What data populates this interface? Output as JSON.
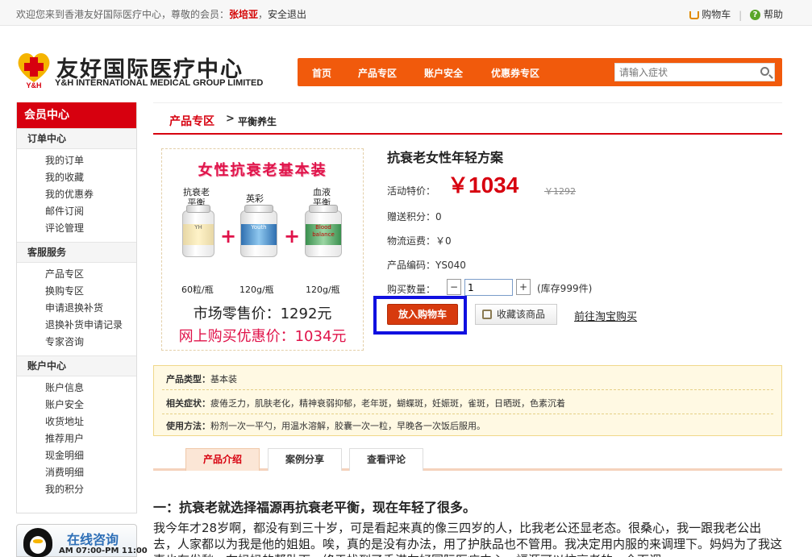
{
  "topbar": {
    "welcome_prefix": "欢迎您来到香港友好国际医疗中心，尊敬的会员：",
    "username": "张培亚",
    "logout": "安全退出",
    "cart": "购物车",
    "help": "帮助"
  },
  "logo": {
    "cn": "友好国际医疗中心",
    "en": "Y&H INTERNATIONAL MEDICAL GROUP LIMITED",
    "mark": "Y&H"
  },
  "nav": {
    "items": [
      "首页",
      "产品专区",
      "账户安全",
      "优惠券专区"
    ],
    "search_placeholder": "请输入症状"
  },
  "sidebar": {
    "title": "会员中心",
    "sections": [
      {
        "title": "订单中心",
        "items": [
          "我的订单",
          "我的收藏",
          "我的优惠券",
          "邮件订阅",
          "评论管理"
        ]
      },
      {
        "title": "客服服务",
        "items": [
          "产品专区",
          "换购专区",
          "申请退换补货",
          "退换补货申请记录",
          "专家咨询"
        ]
      },
      {
        "title": "账户中心",
        "items": [
          "账户信息",
          "账户安全",
          "收货地址",
          "推荐用户",
          "现金明细",
          "消费明细",
          "我的积分"
        ]
      }
    ]
  },
  "consult": {
    "title": "在线咨询",
    "hours": "AM 07:00-PM 11:00"
  },
  "breadcrumb": {
    "category": "产品专区",
    "arrow": ">",
    "current": "平衡养生"
  },
  "image": {
    "title": "女性抗衰老基本装",
    "products": [
      {
        "name_line1": "抗衰老",
        "name_line2": "平衡",
        "qty": "60粒/瓶"
      },
      {
        "name_line1": "英彩",
        "name_line2": "",
        "qty": "120g/瓶"
      },
      {
        "name_line1": "血液",
        "name_line2": "平衡",
        "qty": "120g/瓶"
      }
    ],
    "plus": "+",
    "market_price": "市场零售价：1292元",
    "online_price": "网上购买优惠价：1034元",
    "bottle_labels": [
      "YH",
      "Youth",
      "Blood balance"
    ]
  },
  "product": {
    "name": "抗衰老女性年轻方案",
    "promo_label": "活动特价：",
    "currency": "￥",
    "price": "1034",
    "original_price": "￥1292",
    "points_label": "赠送积分：",
    "points": "0",
    "shipping_label": "物流运费：",
    "shipping": "￥0",
    "code_label": "产品编码：",
    "code": "YS040",
    "qty_label": "购买数量：",
    "qty_minus": "−",
    "qty_value": "1",
    "qty_plus": "+",
    "stock": "(库存999件)",
    "add_to_cart": "放入购物车",
    "favorite": "收藏该商品",
    "taobao": "前往淘宝购买"
  },
  "attributes": [
    {
      "label": "产品类型：",
      "value": "基本装"
    },
    {
      "label": "相关症状：",
      "value": "疲倦乏力，肌肤老化，精神衰弱抑郁，老年斑，蝴蝶斑，妊娠斑，雀斑，日晒斑，色素沉着"
    },
    {
      "label": "使用方法：",
      "value": "粉剂一次一平勺，用温水溶解，胶囊一次一粒，早晚各一次饭后服用。"
    }
  ],
  "tabs": [
    "产品介绍",
    "案例分享",
    "查看评论"
  ],
  "article": {
    "title": "一：抗衰老就选择福源再抗衰老平衡，现在年轻了很多。",
    "body": "我今年才28岁啊，都没有到三十岁，可是看起来真的像三四岁的人，比我老公还显老态。很桑心，我一跟我老公出去，人家都以为我是他的姐姐。唉，真的是没有办法，用了护肤品也不管用。我决定用内服的来调理下。妈妈为了我这事也有发愁，在妈妈的帮助下，终于找到了香港友好国际医疗中心，福源可以抗衰老的，全面调"
  },
  "colors": {
    "brand_red": "#d7000f",
    "nav_orange": "#f15a0c",
    "highlight_blue": "#1010e0",
    "pink_text": "#e0134a"
  }
}
